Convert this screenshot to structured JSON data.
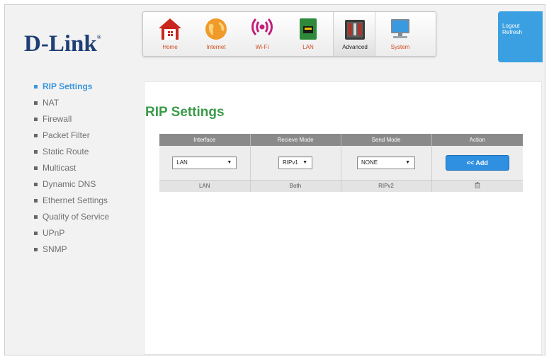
{
  "brand": {
    "logo_text": "D-Link",
    "logo_mark": "®"
  },
  "nav": {
    "items": [
      {
        "id": "home",
        "label": "Home",
        "icon": "home-icon"
      },
      {
        "id": "internet",
        "label": "Internet",
        "icon": "globe-icon"
      },
      {
        "id": "wifi",
        "label": "Wi-Fi",
        "icon": "wifi-icon"
      },
      {
        "id": "lan",
        "label": "LAN",
        "icon": "lan-icon"
      },
      {
        "id": "advanced",
        "label": "Advanced",
        "icon": "toolbox-icon",
        "active": true
      },
      {
        "id": "system",
        "label": "System",
        "icon": "computer-icon"
      }
    ]
  },
  "account": {
    "logout": "Logout",
    "refresh": "Refresh"
  },
  "sidebar": {
    "items": [
      {
        "label": "RIP Settings",
        "active": true
      },
      {
        "label": "NAT"
      },
      {
        "label": "Firewall"
      },
      {
        "label": "Packet Filter"
      },
      {
        "label": "Static Route"
      },
      {
        "label": "Multicast"
      },
      {
        "label": "Dynamic DNS"
      },
      {
        "label": "Ethernet Settings"
      },
      {
        "label": "Quality of Service"
      },
      {
        "label": "UPnP"
      },
      {
        "label": "SNMP"
      }
    ]
  },
  "page": {
    "title": "RIP Settings"
  },
  "table": {
    "headers": [
      "Interface",
      "Recieve Mode",
      "Send Mode",
      "Action"
    ],
    "input": {
      "interface": "LAN",
      "receive_mode": "RIPv1",
      "send_mode": "NONE",
      "add_label": "<< Add",
      "dropdown_arrow": "▼"
    },
    "rows": [
      {
        "interface": "LAN",
        "receive_mode": "Both",
        "send_mode": "RIPv2",
        "action_icon": "trash-icon"
      }
    ]
  },
  "colors": {
    "brand_blue": "#1d3f74",
    "accent_blue": "#3a95dc",
    "title_green": "#3b9b4a",
    "nav_label_orange": "#d04a1f",
    "header_gray": "#8a8a8a"
  }
}
